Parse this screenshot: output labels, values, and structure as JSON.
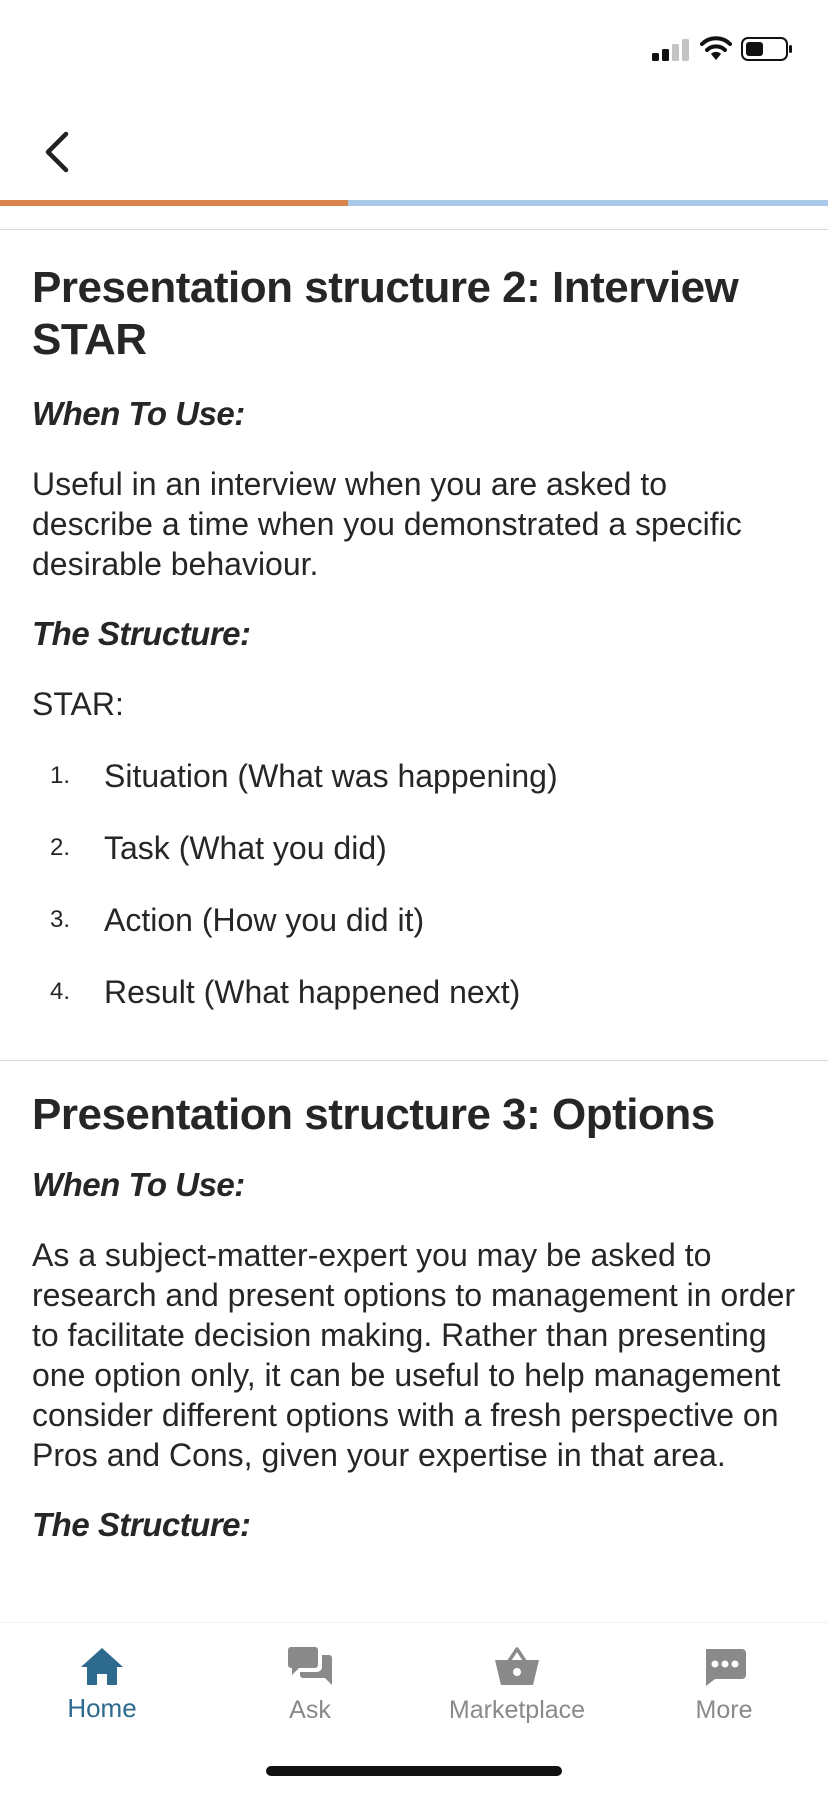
{
  "colors": {
    "accent": "#d9844d",
    "progress_track": "#a9c8ea",
    "tab_active": "#2e6a8e",
    "tab_inactive": "#8a8a8a"
  },
  "status_bar": {
    "icons": [
      "signal-icon",
      "wifi-icon",
      "battery-icon"
    ]
  },
  "nav": {
    "back_icon": "chevron-left-icon"
  },
  "progress": {
    "fraction": 0.42
  },
  "sections": [
    {
      "title": "Presentation structure 2: Interview STAR",
      "when_heading": "When To Use:",
      "when_text": "Useful in an interview when you are asked to describe a time when you demonstrated a specific desirable behaviour.",
      "structure_heading": "The Structure:",
      "structure_intro": "STAR:",
      "steps": [
        {
          "num": "1.",
          "text": "Situation (What was happening)"
        },
        {
          "num": "2.",
          "text": "Task (What you did)"
        },
        {
          "num": "3.",
          "text": "Action (How you did it)"
        },
        {
          "num": "4.",
          "text": "Result (What happened next)"
        }
      ]
    },
    {
      "title": "Presentation structure 3: Options",
      "when_heading": "When To Use:",
      "when_text": "As a subject-matter-expert you may be asked to research and present options to management in order to facilitate decision making. Rather than presenting one option only, it can be useful to help management consider different options with a fresh perspective on Pros and Cons, given your expertise in that area.",
      "structure_heading": "The Structure:"
    }
  ],
  "tabs": [
    {
      "label": "Home",
      "icon": "home-icon",
      "active": true
    },
    {
      "label": "Ask",
      "icon": "chat-bubbles-icon",
      "active": false
    },
    {
      "label": "Marketplace",
      "icon": "basket-icon",
      "active": false
    },
    {
      "label": "More",
      "icon": "more-dots-icon",
      "active": false
    }
  ]
}
